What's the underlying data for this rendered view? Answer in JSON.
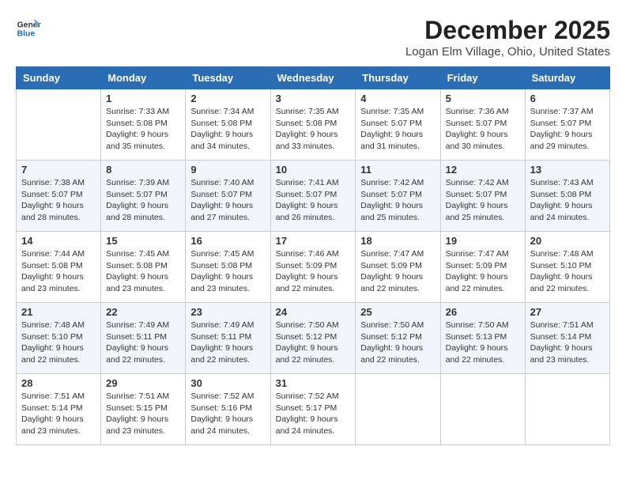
{
  "header": {
    "logo_line1": "General",
    "logo_line2": "Blue",
    "title": "December 2025",
    "subtitle": "Logan Elm Village, Ohio, United States"
  },
  "days_of_week": [
    "Sunday",
    "Monday",
    "Tuesday",
    "Wednesday",
    "Thursday",
    "Friday",
    "Saturday"
  ],
  "weeks": [
    [
      {
        "day": "",
        "sunrise": "",
        "sunset": "",
        "daylight": ""
      },
      {
        "day": "1",
        "sunrise": "Sunrise: 7:33 AM",
        "sunset": "Sunset: 5:08 PM",
        "daylight": "Daylight: 9 hours and 35 minutes."
      },
      {
        "day": "2",
        "sunrise": "Sunrise: 7:34 AM",
        "sunset": "Sunset: 5:08 PM",
        "daylight": "Daylight: 9 hours and 34 minutes."
      },
      {
        "day": "3",
        "sunrise": "Sunrise: 7:35 AM",
        "sunset": "Sunset: 5:08 PM",
        "daylight": "Daylight: 9 hours and 33 minutes."
      },
      {
        "day": "4",
        "sunrise": "Sunrise: 7:35 AM",
        "sunset": "Sunset: 5:07 PM",
        "daylight": "Daylight: 9 hours and 31 minutes."
      },
      {
        "day": "5",
        "sunrise": "Sunrise: 7:36 AM",
        "sunset": "Sunset: 5:07 PM",
        "daylight": "Daylight: 9 hours and 30 minutes."
      },
      {
        "day": "6",
        "sunrise": "Sunrise: 7:37 AM",
        "sunset": "Sunset: 5:07 PM",
        "daylight": "Daylight: 9 hours and 29 minutes."
      }
    ],
    [
      {
        "day": "7",
        "sunrise": "Sunrise: 7:38 AM",
        "sunset": "Sunset: 5:07 PM",
        "daylight": "Daylight: 9 hours and 28 minutes."
      },
      {
        "day": "8",
        "sunrise": "Sunrise: 7:39 AM",
        "sunset": "Sunset: 5:07 PM",
        "daylight": "Daylight: 9 hours and 28 minutes."
      },
      {
        "day": "9",
        "sunrise": "Sunrise: 7:40 AM",
        "sunset": "Sunset: 5:07 PM",
        "daylight": "Daylight: 9 hours and 27 minutes."
      },
      {
        "day": "10",
        "sunrise": "Sunrise: 7:41 AM",
        "sunset": "Sunset: 5:07 PM",
        "daylight": "Daylight: 9 hours and 26 minutes."
      },
      {
        "day": "11",
        "sunrise": "Sunrise: 7:42 AM",
        "sunset": "Sunset: 5:07 PM",
        "daylight": "Daylight: 9 hours and 25 minutes."
      },
      {
        "day": "12",
        "sunrise": "Sunrise: 7:42 AM",
        "sunset": "Sunset: 5:07 PM",
        "daylight": "Daylight: 9 hours and 25 minutes."
      },
      {
        "day": "13",
        "sunrise": "Sunrise: 7:43 AM",
        "sunset": "Sunset: 5:08 PM",
        "daylight": "Daylight: 9 hours and 24 minutes."
      }
    ],
    [
      {
        "day": "14",
        "sunrise": "Sunrise: 7:44 AM",
        "sunset": "Sunset: 5:08 PM",
        "daylight": "Daylight: 9 hours and 23 minutes."
      },
      {
        "day": "15",
        "sunrise": "Sunrise: 7:45 AM",
        "sunset": "Sunset: 5:08 PM",
        "daylight": "Daylight: 9 hours and 23 minutes."
      },
      {
        "day": "16",
        "sunrise": "Sunrise: 7:45 AM",
        "sunset": "Sunset: 5:08 PM",
        "daylight": "Daylight: 9 hours and 23 minutes."
      },
      {
        "day": "17",
        "sunrise": "Sunrise: 7:46 AM",
        "sunset": "Sunset: 5:09 PM",
        "daylight": "Daylight: 9 hours and 22 minutes."
      },
      {
        "day": "18",
        "sunrise": "Sunrise: 7:47 AM",
        "sunset": "Sunset: 5:09 PM",
        "daylight": "Daylight: 9 hours and 22 minutes."
      },
      {
        "day": "19",
        "sunrise": "Sunrise: 7:47 AM",
        "sunset": "Sunset: 5:09 PM",
        "daylight": "Daylight: 9 hours and 22 minutes."
      },
      {
        "day": "20",
        "sunrise": "Sunrise: 7:48 AM",
        "sunset": "Sunset: 5:10 PM",
        "daylight": "Daylight: 9 hours and 22 minutes."
      }
    ],
    [
      {
        "day": "21",
        "sunrise": "Sunrise: 7:48 AM",
        "sunset": "Sunset: 5:10 PM",
        "daylight": "Daylight: 9 hours and 22 minutes."
      },
      {
        "day": "22",
        "sunrise": "Sunrise: 7:49 AM",
        "sunset": "Sunset: 5:11 PM",
        "daylight": "Daylight: 9 hours and 22 minutes."
      },
      {
        "day": "23",
        "sunrise": "Sunrise: 7:49 AM",
        "sunset": "Sunset: 5:11 PM",
        "daylight": "Daylight: 9 hours and 22 minutes."
      },
      {
        "day": "24",
        "sunrise": "Sunrise: 7:50 AM",
        "sunset": "Sunset: 5:12 PM",
        "daylight": "Daylight: 9 hours and 22 minutes."
      },
      {
        "day": "25",
        "sunrise": "Sunrise: 7:50 AM",
        "sunset": "Sunset: 5:12 PM",
        "daylight": "Daylight: 9 hours and 22 minutes."
      },
      {
        "day": "26",
        "sunrise": "Sunrise: 7:50 AM",
        "sunset": "Sunset: 5:13 PM",
        "daylight": "Daylight: 9 hours and 22 minutes."
      },
      {
        "day": "27",
        "sunrise": "Sunrise: 7:51 AM",
        "sunset": "Sunset: 5:14 PM",
        "daylight": "Daylight: 9 hours and 23 minutes."
      }
    ],
    [
      {
        "day": "28",
        "sunrise": "Sunrise: 7:51 AM",
        "sunset": "Sunset: 5:14 PM",
        "daylight": "Daylight: 9 hours and 23 minutes."
      },
      {
        "day": "29",
        "sunrise": "Sunrise: 7:51 AM",
        "sunset": "Sunset: 5:15 PM",
        "daylight": "Daylight: 9 hours and 23 minutes."
      },
      {
        "day": "30",
        "sunrise": "Sunrise: 7:52 AM",
        "sunset": "Sunset: 5:16 PM",
        "daylight": "Daylight: 9 hours and 24 minutes."
      },
      {
        "day": "31",
        "sunrise": "Sunrise: 7:52 AM",
        "sunset": "Sunset: 5:17 PM",
        "daylight": "Daylight: 9 hours and 24 minutes."
      },
      {
        "day": "",
        "sunrise": "",
        "sunset": "",
        "daylight": ""
      },
      {
        "day": "",
        "sunrise": "",
        "sunset": "",
        "daylight": ""
      },
      {
        "day": "",
        "sunrise": "",
        "sunset": "",
        "daylight": ""
      }
    ]
  ]
}
